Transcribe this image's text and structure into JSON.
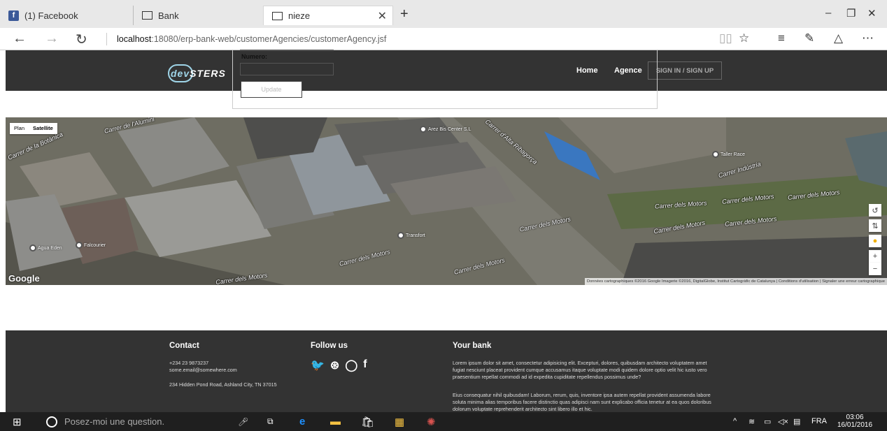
{
  "browser": {
    "tabs": [
      {
        "label": "(1) Facebook",
        "icon": "facebook-icon"
      },
      {
        "label": "Bank",
        "icon": "page-icon"
      },
      {
        "label": "nieze",
        "icon": "page-icon",
        "active": true
      }
    ],
    "new_tab": "+",
    "window_controls": {
      "minimize": "–",
      "restore": "❐",
      "close": "✕"
    },
    "url_host": "localhost",
    "url_path": ":18080/erp-bank-web/customerAgencies/customerAgency.jsf"
  },
  "site": {
    "logo_text_a": "dev",
    "logo_text_b": "STERS",
    "nav": {
      "home": "Home",
      "agence": "Agence",
      "sign": "SIGN IN / SIGN UP"
    }
  },
  "form": {
    "numero_label": "Numero:",
    "numero_value": "",
    "update_label": "Update"
  },
  "map": {
    "toggle_plan": "Plan",
    "toggle_satellite": "Satellite",
    "google": "Google",
    "attribution": "Données cartographiques ©2016 Google Imagerie ©2016, DigitalGlobe, Institut Cartogràfic de Catalunya | Conditions d'utilisation | Signaler une erreur cartographique",
    "pois": [
      "Arez Bis Center S.L",
      "Taller Race",
      "Transfort",
      "Agua Eden",
      "Falcourier"
    ],
    "streets": [
      "Carrer de la Botànica",
      "Carrer de l'Alumini",
      "Carrer d'Alta Ribagorça",
      "Carrer dels Motors",
      "Carrer dels Motors",
      "Carrer dels Motors",
      "Carrer dels Motors",
      "Carrer dels Motors",
      "Carrer dels Motors",
      "Carrer dels Motors",
      "Carrer dels Motors",
      "Carrer Indústria",
      "Carrer dels Motors"
    ],
    "controls": {
      "rotate": "↺",
      "tilt": "⇅",
      "zoom_in": "+",
      "zoom_out": "−"
    }
  },
  "footer": {
    "contact_title": "Contact",
    "phone": "+234 23 9873237",
    "email": "some.email@somewhere.com",
    "address": "234 Hidden Pond Road, Ashland City, TN 37015",
    "follow_title": "Follow us",
    "social_icons": [
      "twitter-icon",
      "dribbble-icon",
      "github-icon",
      "facebook-icon"
    ],
    "bank_title": "Your bank",
    "bank_p1": "Lorem ipsum dolor sit amet, consectetur adipisicing elit. Excepturi, dolores, quibusdam architecto voluptatem amet fugiat nesciunt placeat provident cumque accusamus itaque voluptate modi quidem dolore optio velit hic iusto vero praesentium repellat commodi ad id expedita cupiditate repellendus possimus unde?",
    "bank_p2": "Eius consequatur nihil quibusdam! Laborum, rerum, quis, inventore ipsa autem repellat provident assumenda labore soluta minima alias temporibus facere distinctio quas adipisci nam sunt explicabo officia tenetur at ea quos doloribus dolorum voluptate reprehenderit architecto sint libero illo et hic."
  },
  "taskbar": {
    "search_placeholder": "Posez-moi une question.",
    "lang": "FRA",
    "time": "03:06",
    "date": "16/01/2016"
  }
}
